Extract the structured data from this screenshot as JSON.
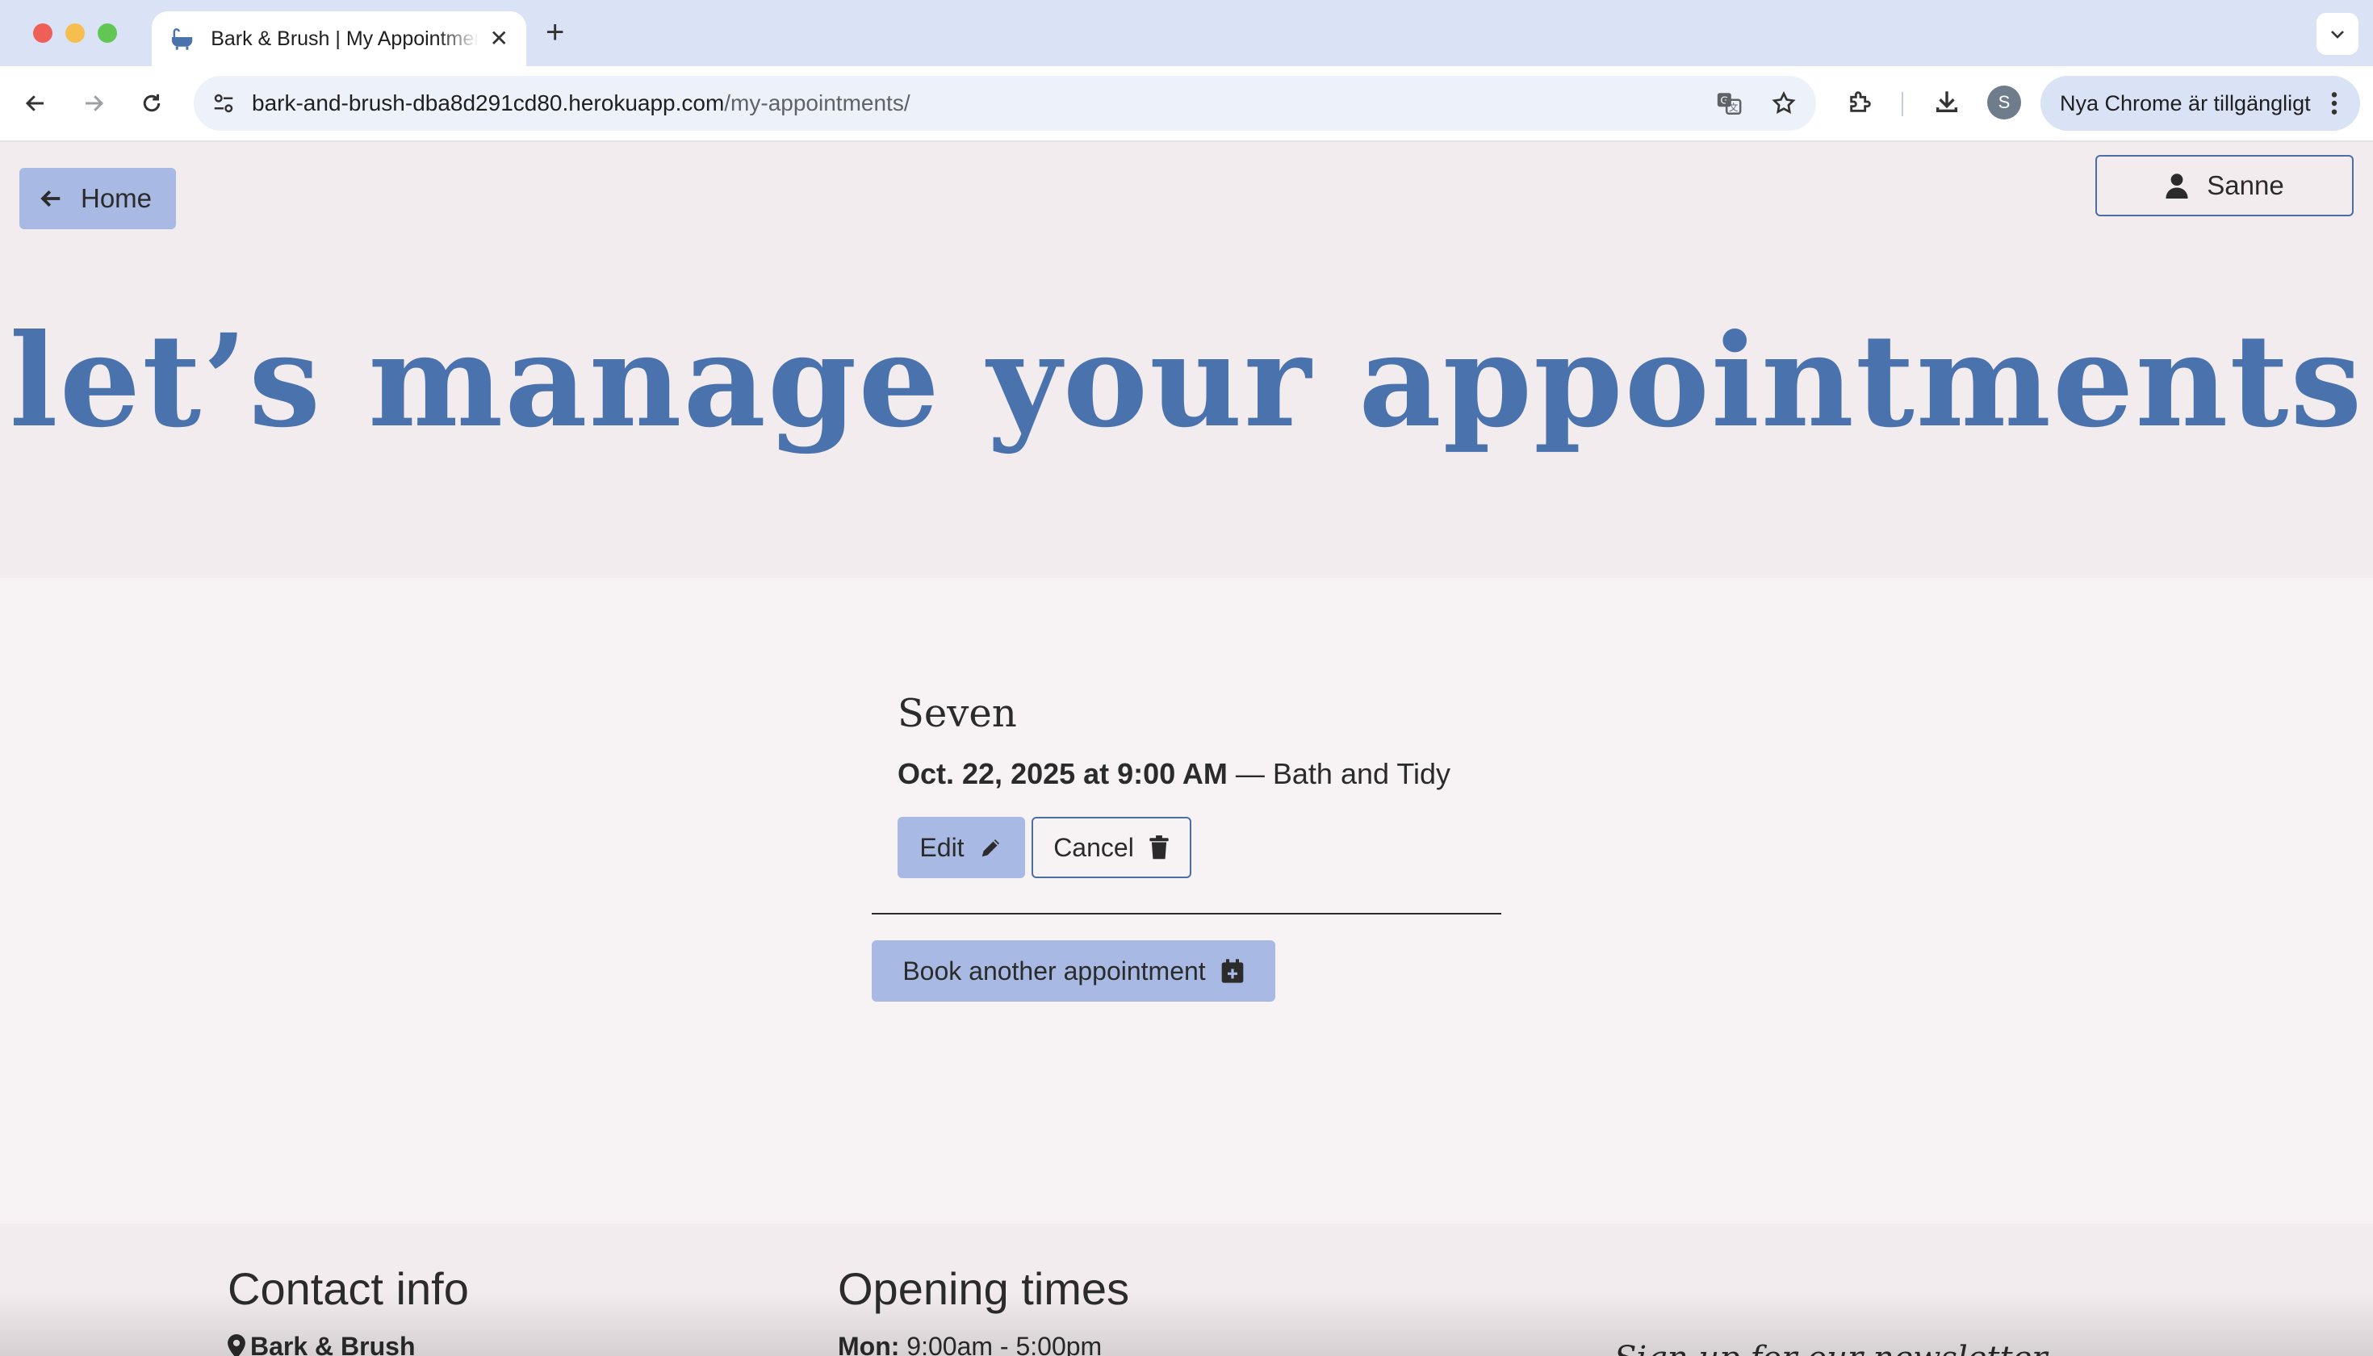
{
  "browser": {
    "tab_title": "Bark & Brush | My Appointments",
    "url_host": "bark-and-brush-dba8d291cd80.herokuapp.com",
    "url_path": "/my-appointments/",
    "profile_initial": "S",
    "update_label": "Nya Chrome är tillgängligt"
  },
  "header": {
    "home_label": "Home",
    "user_label": "Sanne",
    "hero_title": "let’s manage your appointments"
  },
  "appointment": {
    "pet_name": "Seven",
    "datetime": "Oct. 22, 2025 at 9:00 AM",
    "separator": " — ",
    "service": "Bath and Tidy",
    "edit_label": "Edit",
    "cancel_label": "Cancel"
  },
  "book_label": "Book another appointment",
  "footer": {
    "contact_heading": "Contact info",
    "contact_name": "Bark & Brush",
    "hours_heading": "Opening times",
    "hours_day": "Mon:",
    "hours_time": " 9:00am - 5:00pm",
    "newsletter_text": "Sign up for our newsletter"
  },
  "colors": {
    "accent": "#4a73ad",
    "button_fill": "#a8b9e3",
    "hero_bg": "#f2ecee",
    "main_bg": "#f7f2f3"
  }
}
